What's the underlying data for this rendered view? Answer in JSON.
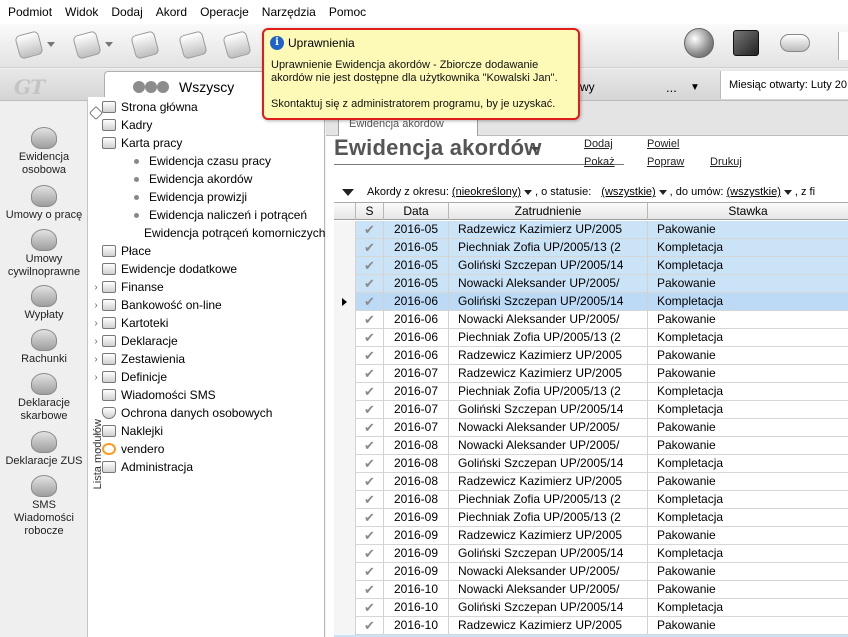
{
  "menu": [
    "Podmiot",
    "Widok",
    "Dodaj",
    "Akord",
    "Operacje",
    "Narzędzia",
    "Pomoc"
  ],
  "header": {
    "logo_text": "GT",
    "tab_all": "Wszyscy",
    "tab_right_text": "wy",
    "tab_right_dots": "...",
    "month_open": "Miesiąc otwarty: Luty 20"
  },
  "icons": {
    "toolbar": [
      "back-icon",
      "forward-icon",
      "stamp-icon",
      "eraser-icon",
      "cancel-icon",
      "globe-icon",
      "cube-icon",
      "cloud-icon"
    ],
    "info": "i"
  },
  "leftbar": [
    {
      "label": "Ewidencja osobowa",
      "icon": "person-icon"
    },
    {
      "label": "Umowy o pracę",
      "icon": "handshake-icon"
    },
    {
      "label": "Umowy cywilnoprawne",
      "icon": "document-handshake-icon"
    },
    {
      "label": "Wypłaty",
      "icon": "money-icon"
    },
    {
      "label": "Rachunki",
      "icon": "receipt-icon"
    },
    {
      "label": "Deklaracje skarbowe",
      "icon": "tax-icon"
    },
    {
      "label": "Deklaracje ZUS",
      "icon": "zus-icon"
    },
    {
      "label": "SMS Wiadomości robocze",
      "icon": "sms-icon"
    }
  ],
  "modules": {
    "vertical_label": "Lista modułów",
    "items": [
      {
        "label": "Strona główna",
        "expandable": false,
        "sub": false
      },
      {
        "label": "Kadry",
        "expandable": false,
        "sub": false
      },
      {
        "label": "Karta pracy",
        "expandable": false,
        "sub": false
      },
      {
        "label": "Ewidencja czasu pracy",
        "expandable": false,
        "sub": true
      },
      {
        "label": "Ewidencja akordów",
        "expandable": false,
        "sub": true
      },
      {
        "label": "Ewidencja prowizji",
        "expandable": false,
        "sub": true
      },
      {
        "label": "Ewidencja naliczeń i potrąceń",
        "expandable": false,
        "sub": true
      },
      {
        "label": "Ewidencja potrąceń komorniczych",
        "expandable": false,
        "sub": true
      },
      {
        "label": "Płace",
        "expandable": false,
        "sub": false
      },
      {
        "label": "Ewidencje dodatkowe",
        "expandable": false,
        "sub": false
      },
      {
        "label": "Finanse",
        "expandable": true,
        "sub": false
      },
      {
        "label": "Bankowość on-line",
        "expandable": true,
        "sub": false
      },
      {
        "label": "Kartoteki",
        "expandable": true,
        "sub": false
      },
      {
        "label": "Deklaracje",
        "expandable": true,
        "sub": false
      },
      {
        "label": "Zestawienia",
        "expandable": true,
        "sub": false
      },
      {
        "label": "Definicje",
        "expandable": true,
        "sub": false
      },
      {
        "label": "Wiadomości SMS",
        "expandable": false,
        "sub": false
      },
      {
        "label": "Ochrona danych osobowych",
        "expandable": false,
        "sub": false
      },
      {
        "label": "Naklejki",
        "expandable": true,
        "sub": false
      },
      {
        "label": "vendero",
        "expandable": true,
        "sub": false
      },
      {
        "label": "Administracja",
        "expandable": false,
        "sub": false
      }
    ]
  },
  "main": {
    "tab_label": "Ewidencja akordów",
    "title": "Ewidencja akordów",
    "actions": {
      "add": "Dodaj",
      "show": "Pokaż",
      "repeat": "Powiel",
      "fix": "Popraw",
      "print": "Drukuj"
    },
    "filters": {
      "period_label": "Akordy z okresu:",
      "period_value": "(nieokreślony)",
      "status_label": ", o statusie:",
      "status_value": "(wszystkie)",
      "contracts_label": ", do umów:",
      "contracts_value": "(wszystkie)",
      "tail": ", z fi"
    },
    "columns": [
      "S",
      "Data",
      "Zatrudnienie",
      "Stawka"
    ],
    "rows": [
      {
        "data": "2016-05",
        "zatrudnienie": "Radzewicz Kazimierz UP/2005",
        "stawka": "Pakowanie",
        "state": "sel"
      },
      {
        "data": "2016-05",
        "zatrudnienie": "Piechniak Zofia UP/2005/13 (2",
        "stawka": "Kompletacja",
        "state": "sel"
      },
      {
        "data": "2016-05",
        "zatrudnienie": "Goliński Szczepan UP/2005/14",
        "stawka": "Kompletacja",
        "state": "sel"
      },
      {
        "data": "2016-05",
        "zatrudnienie": "Nowacki Aleksander UP/2005/",
        "stawka": "Pakowanie",
        "state": "sel"
      },
      {
        "data": "2016-06",
        "zatrudnienie": "Goliński Szczepan UP/2005/14",
        "stawka": "Kompletacja",
        "state": "cur"
      },
      {
        "data": "2016-06",
        "zatrudnienie": "Nowacki Aleksander UP/2005/",
        "stawka": "Pakowanie",
        "state": ""
      },
      {
        "data": "2016-06",
        "zatrudnienie": "Piechniak Zofia UP/2005/13 (2",
        "stawka": "Kompletacja",
        "state": ""
      },
      {
        "data": "2016-06",
        "zatrudnienie": "Radzewicz Kazimierz UP/2005",
        "stawka": "Pakowanie",
        "state": ""
      },
      {
        "data": "2016-07",
        "zatrudnienie": "Radzewicz Kazimierz UP/2005",
        "stawka": "Pakowanie",
        "state": ""
      },
      {
        "data": "2016-07",
        "zatrudnienie": "Piechniak Zofia UP/2005/13 (2",
        "stawka": "Kompletacja",
        "state": ""
      },
      {
        "data": "2016-07",
        "zatrudnienie": "Goliński Szczepan UP/2005/14",
        "stawka": "Kompletacja",
        "state": ""
      },
      {
        "data": "2016-07",
        "zatrudnienie": "Nowacki Aleksander UP/2005/",
        "stawka": "Pakowanie",
        "state": ""
      },
      {
        "data": "2016-08",
        "zatrudnienie": "Nowacki Aleksander UP/2005/",
        "stawka": "Pakowanie",
        "state": ""
      },
      {
        "data": "2016-08",
        "zatrudnienie": "Goliński Szczepan UP/2005/14",
        "stawka": "Kompletacja",
        "state": ""
      },
      {
        "data": "2016-08",
        "zatrudnienie": "Radzewicz Kazimierz UP/2005",
        "stawka": "Pakowanie",
        "state": ""
      },
      {
        "data": "2016-08",
        "zatrudnienie": "Piechniak Zofia UP/2005/13 (2",
        "stawka": "Kompletacja",
        "state": ""
      },
      {
        "data": "2016-09",
        "zatrudnienie": "Piechniak Zofia UP/2005/13 (2",
        "stawka": "Kompletacja",
        "state": ""
      },
      {
        "data": "2016-09",
        "zatrudnienie": "Radzewicz Kazimierz UP/2005",
        "stawka": "Pakowanie",
        "state": ""
      },
      {
        "data": "2016-09",
        "zatrudnienie": "Goliński Szczepan UP/2005/14",
        "stawka": "Kompletacja",
        "state": ""
      },
      {
        "data": "2016-09",
        "zatrudnienie": "Nowacki Aleksander UP/2005/",
        "stawka": "Pakowanie",
        "state": ""
      },
      {
        "data": "2016-10",
        "zatrudnienie": "Nowacki Aleksander UP/2005/",
        "stawka": "Pakowanie",
        "state": ""
      },
      {
        "data": "2016-10",
        "zatrudnienie": "Goliński Szczepan UP/2005/14",
        "stawka": "Kompletacja",
        "state": ""
      },
      {
        "data": "2016-10",
        "zatrudnienie": "Radzewicz Kazimierz UP/2005",
        "stawka": "Pakowanie",
        "state": ""
      }
    ]
  },
  "tooltip": {
    "title": "Uprawnienia",
    "line1": "Uprawnienie Ewidencja akordów - Zbiorcze dodawanie akordów nie jest dostępne dla użytkownika \"Kowalski Jan\".",
    "line2": "Skontaktuj się z administratorem programu, by je uzyskać."
  },
  "colors": {
    "selected_row": "#cbe3f7",
    "current_row": "#bcdaf5",
    "tooltip_bg": "#fdfab8",
    "tooltip_border": "#e01d1d",
    "info_icon": "#1f63c8"
  }
}
